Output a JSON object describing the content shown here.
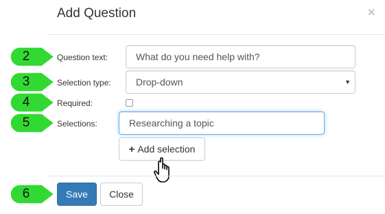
{
  "modal": {
    "title": "Add Question",
    "close_symbol": "×"
  },
  "form": {
    "question_text": {
      "label": "Question text:",
      "value": "What do you need help with?"
    },
    "selection_type": {
      "label": "Selection type:",
      "value": "Drop-down",
      "arrow": "▼"
    },
    "required": {
      "label": "Required:",
      "checked": false
    },
    "selections": {
      "label": "Selections:",
      "value": "Researching a topic"
    },
    "add_selection": {
      "icon": "+",
      "label": "Add selection"
    }
  },
  "footer": {
    "save_label": "Save",
    "close_label": "Close"
  },
  "callouts": [
    {
      "number": "2"
    },
    {
      "number": "3"
    },
    {
      "number": "4"
    },
    {
      "number": "5"
    },
    {
      "number": "6"
    }
  ],
  "colors": {
    "callout_fill": "#33d933",
    "primary": "#337ab7",
    "focus_border": "#66afe9"
  },
  "icons": {
    "cursor": "hand-pointer-icon",
    "plus": "plus-icon"
  }
}
